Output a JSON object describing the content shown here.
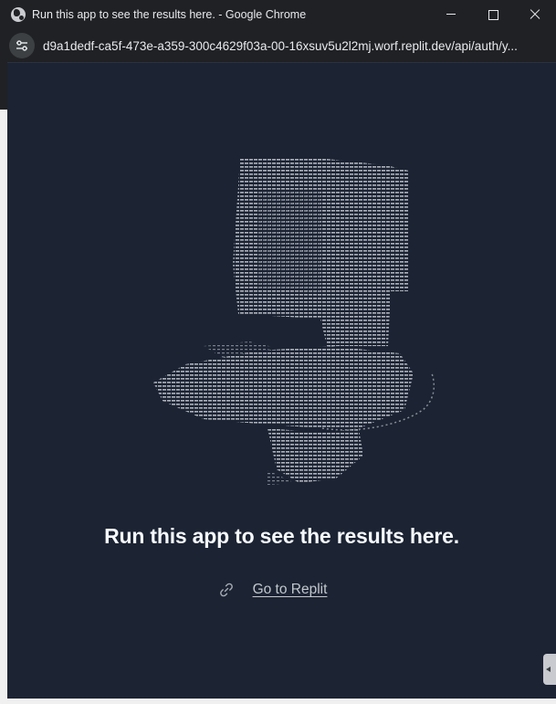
{
  "window": {
    "title": "Run this app to see the results here. - Google Chrome",
    "app_icon": "chrome-globe-icon",
    "controls": [
      "minimize-icon",
      "maximize-icon",
      "close-icon"
    ]
  },
  "address_bar": {
    "site_info_icon": "tune-icon",
    "url": "d9a1dedf-ca5f-473e-a359-300c4629f03a-00-16xsuv5u2l2mj.worf.replit.dev/api/auth/y..."
  },
  "page": {
    "illustration": "ascii-art-chair-illustration",
    "headline": "Run this app to see the results here.",
    "link_icon": "link-icon",
    "link_label": "Go to Replit"
  },
  "colors": {
    "background": "#1c2333",
    "chrome": "#202124",
    "headline": "#f5f9fc",
    "link": "#c2c8cc"
  }
}
